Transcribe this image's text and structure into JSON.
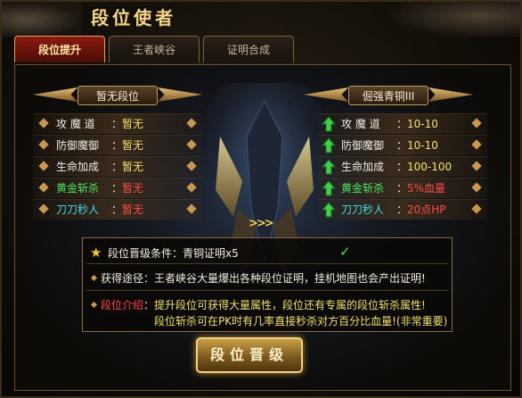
{
  "title": "段位使者",
  "tabs": [
    {
      "label": "段位提升",
      "active": true
    },
    {
      "label": "王者峡谷",
      "active": false
    },
    {
      "label": "证明合成",
      "active": false
    }
  ],
  "current_rank": {
    "name": "暂无段位",
    "attributes": [
      {
        "label": "攻 魔 道",
        "value": "暂无"
      },
      {
        "label": "防御魔御",
        "value": "暂无"
      },
      {
        "label": "生命加成",
        "value": "暂无"
      },
      {
        "label": "黄金斩杀",
        "value": "暂无"
      },
      {
        "label": "刀刀秒人",
        "value": "暂无"
      }
    ]
  },
  "next_rank": {
    "name": "倔强青铜III",
    "attributes": [
      {
        "label": "攻 魔 道",
        "value": "10-10"
      },
      {
        "label": "防御魔御",
        "value": "10-10"
      },
      {
        "label": "生命加成",
        "value": "100-100"
      },
      {
        "label": "黄金斩杀",
        "value": "5%血量"
      },
      {
        "label": "刀刀秒人",
        "value": "20点HP"
      }
    ]
  },
  "mid_arrows": ">>>",
  "info": {
    "condition_label": "段位晋级条件",
    "condition_value": "青铜证明x5",
    "check": "✓",
    "source_label": "获得途径",
    "source_text": "王者峡谷大量爆出各种段位证明，挂机地图也会产出证明!",
    "intro_label": "段位介绍",
    "intro_line1": "提升段位可获得大量属性，段位还有专属的段位斩杀属性!",
    "intro_line2": "段位斩杀可在PK时有几率直接秒杀对方百分比血量!(非常重要)"
  },
  "upgrade_button": "段位晋级",
  "colors": {
    "gold": "#f3d48a",
    "green_arrow": "#4de862",
    "red_value": "#ff4a4a"
  }
}
